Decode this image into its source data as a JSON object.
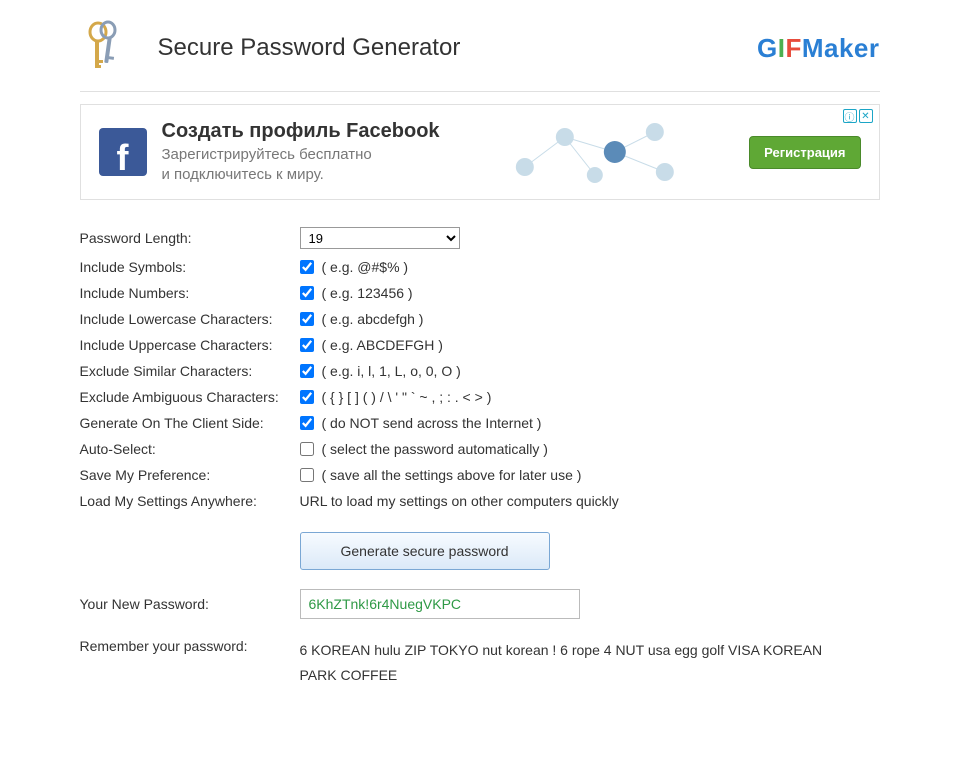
{
  "header": {
    "title": "Secure Password Generator",
    "logo_gif": "GIF",
    "logo_maker": "Maker"
  },
  "ad": {
    "title": "Создать профиль Facebook",
    "subtitle_line1": "Зарегистрируйтесь бесплатно",
    "subtitle_line2": "и подключитесь к миру.",
    "button": "Регистрация"
  },
  "form": {
    "password_length": {
      "label": "Password Length:",
      "value": "19"
    },
    "include_symbols": {
      "label": "Include Symbols:",
      "checked": true,
      "example": "( e.g. @#$% )"
    },
    "include_numbers": {
      "label": "Include Numbers:",
      "checked": true,
      "example": "( e.g. 123456 )"
    },
    "include_lowercase": {
      "label": "Include Lowercase Characters:",
      "checked": true,
      "example": "( e.g. abcdefgh )"
    },
    "include_uppercase": {
      "label": "Include Uppercase Characters:",
      "checked": true,
      "example": "( e.g. ABCDEFGH )"
    },
    "exclude_similar": {
      "label": "Exclude Similar Characters:",
      "checked": true,
      "example": "( e.g. i, l, 1, L, o, 0, O )"
    },
    "exclude_ambiguous": {
      "label": "Exclude Ambiguous Characters:",
      "checked": true,
      "example": "( { } [ ] ( ) / \\ ' \" ` ~ , ; : . < > )"
    },
    "client_side": {
      "label": "Generate On The Client Side:",
      "checked": true,
      "example": "( do NOT send across the Internet )"
    },
    "auto_select": {
      "label": "Auto-Select:",
      "checked": false,
      "example": "( select the password automatically )"
    },
    "save_preference": {
      "label": "Save My Preference:",
      "checked": false,
      "example": "( save all the settings above for later use )"
    },
    "load_settings": {
      "label": "Load My Settings Anywhere:",
      "text": "URL to load my settings on other computers quickly"
    }
  },
  "generate_button": "Generate secure password",
  "output": {
    "label": "Your New Password:",
    "value": "6KhZTnk!6r4NuegVKPC"
  },
  "remember": {
    "label": "Remember your password:",
    "text": "6 KOREAN hulu ZIP TOKYO nut korean ! 6 rope 4 NUT usa egg golf VISA KOREAN PARK COFFEE"
  }
}
